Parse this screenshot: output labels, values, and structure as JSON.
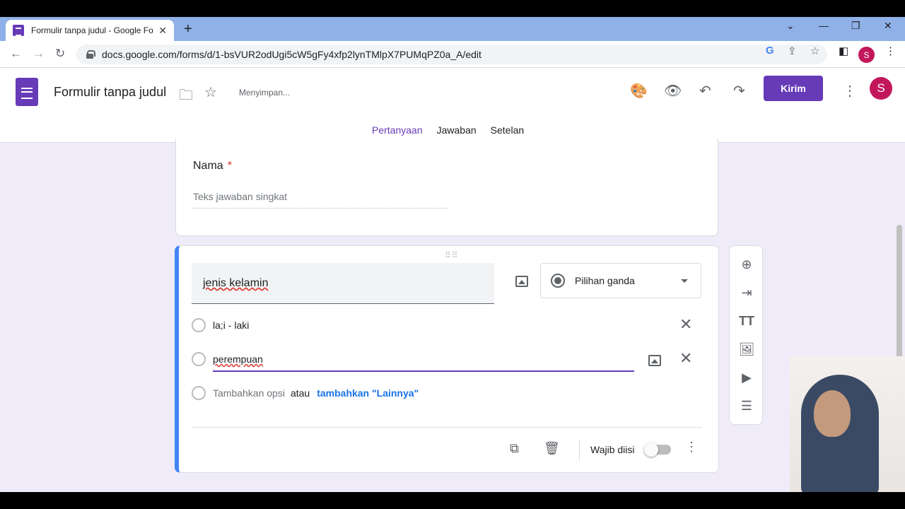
{
  "browser": {
    "tab_title": "Formulir tanpa judul - Google Fo",
    "url": "docs.google.com/forms/d/1-bsVUR2odUgi5cW5gFy4xfp2lynTMlpX7PUMqPZ0a_A/edit",
    "profile_initial": "S"
  },
  "header": {
    "doc_title": "Formulir tanpa judul",
    "saving_status": "Menyimpan...",
    "send_label": "Kirim",
    "avatar_initial": "S",
    "tabs": [
      {
        "label": "Pertanyaan"
      },
      {
        "label": "Jawaban"
      },
      {
        "label": "Setelan"
      }
    ]
  },
  "question1": {
    "title": "Nama",
    "required_mark": "*",
    "placeholder": "Teks jawaban singkat"
  },
  "question2": {
    "title": "jenis kelamin",
    "type_label": "Pilihan ganda",
    "options": [
      {
        "label": "la;i - laki"
      },
      {
        "label": "perempuan"
      }
    ],
    "add_option": "Tambahkan opsi",
    "or": "atau",
    "add_other": "tambahkan \"Lainnya\"",
    "required_label": "Wajib diisi",
    "required_on": false
  },
  "colors": {
    "accent": "#673ab7",
    "tab_strip": "#8fb1e8",
    "background": "#f0ebf8",
    "active_card_border": "#4285f4"
  }
}
